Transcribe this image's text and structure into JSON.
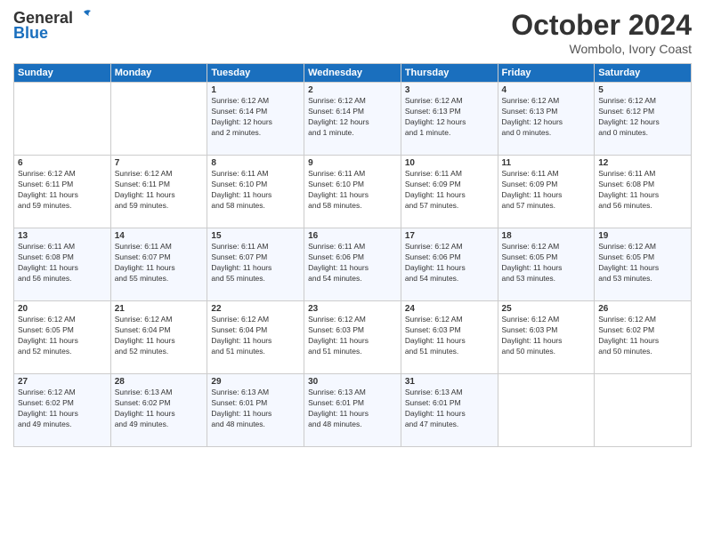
{
  "logo": {
    "line1": "General",
    "line2": "Blue"
  },
  "title": "October 2024",
  "subtitle": "Wombolo, Ivory Coast",
  "days_of_week": [
    "Sunday",
    "Monday",
    "Tuesday",
    "Wednesday",
    "Thursday",
    "Friday",
    "Saturday"
  ],
  "weeks": [
    [
      {
        "day": "",
        "info": ""
      },
      {
        "day": "",
        "info": ""
      },
      {
        "day": "1",
        "info": "Sunrise: 6:12 AM\nSunset: 6:14 PM\nDaylight: 12 hours\nand 2 minutes."
      },
      {
        "day": "2",
        "info": "Sunrise: 6:12 AM\nSunset: 6:14 PM\nDaylight: 12 hours\nand 1 minute."
      },
      {
        "day": "3",
        "info": "Sunrise: 6:12 AM\nSunset: 6:13 PM\nDaylight: 12 hours\nand 1 minute."
      },
      {
        "day": "4",
        "info": "Sunrise: 6:12 AM\nSunset: 6:13 PM\nDaylight: 12 hours\nand 0 minutes."
      },
      {
        "day": "5",
        "info": "Sunrise: 6:12 AM\nSunset: 6:12 PM\nDaylight: 12 hours\nand 0 minutes."
      }
    ],
    [
      {
        "day": "6",
        "info": "Sunrise: 6:12 AM\nSunset: 6:11 PM\nDaylight: 11 hours\nand 59 minutes."
      },
      {
        "day": "7",
        "info": "Sunrise: 6:12 AM\nSunset: 6:11 PM\nDaylight: 11 hours\nand 59 minutes."
      },
      {
        "day": "8",
        "info": "Sunrise: 6:11 AM\nSunset: 6:10 PM\nDaylight: 11 hours\nand 58 minutes."
      },
      {
        "day": "9",
        "info": "Sunrise: 6:11 AM\nSunset: 6:10 PM\nDaylight: 11 hours\nand 58 minutes."
      },
      {
        "day": "10",
        "info": "Sunrise: 6:11 AM\nSunset: 6:09 PM\nDaylight: 11 hours\nand 57 minutes."
      },
      {
        "day": "11",
        "info": "Sunrise: 6:11 AM\nSunset: 6:09 PM\nDaylight: 11 hours\nand 57 minutes."
      },
      {
        "day": "12",
        "info": "Sunrise: 6:11 AM\nSunset: 6:08 PM\nDaylight: 11 hours\nand 56 minutes."
      }
    ],
    [
      {
        "day": "13",
        "info": "Sunrise: 6:11 AM\nSunset: 6:08 PM\nDaylight: 11 hours\nand 56 minutes."
      },
      {
        "day": "14",
        "info": "Sunrise: 6:11 AM\nSunset: 6:07 PM\nDaylight: 11 hours\nand 55 minutes."
      },
      {
        "day": "15",
        "info": "Sunrise: 6:11 AM\nSunset: 6:07 PM\nDaylight: 11 hours\nand 55 minutes."
      },
      {
        "day": "16",
        "info": "Sunrise: 6:11 AM\nSunset: 6:06 PM\nDaylight: 11 hours\nand 54 minutes."
      },
      {
        "day": "17",
        "info": "Sunrise: 6:12 AM\nSunset: 6:06 PM\nDaylight: 11 hours\nand 54 minutes."
      },
      {
        "day": "18",
        "info": "Sunrise: 6:12 AM\nSunset: 6:05 PM\nDaylight: 11 hours\nand 53 minutes."
      },
      {
        "day": "19",
        "info": "Sunrise: 6:12 AM\nSunset: 6:05 PM\nDaylight: 11 hours\nand 53 minutes."
      }
    ],
    [
      {
        "day": "20",
        "info": "Sunrise: 6:12 AM\nSunset: 6:05 PM\nDaylight: 11 hours\nand 52 minutes."
      },
      {
        "day": "21",
        "info": "Sunrise: 6:12 AM\nSunset: 6:04 PM\nDaylight: 11 hours\nand 52 minutes."
      },
      {
        "day": "22",
        "info": "Sunrise: 6:12 AM\nSunset: 6:04 PM\nDaylight: 11 hours\nand 51 minutes."
      },
      {
        "day": "23",
        "info": "Sunrise: 6:12 AM\nSunset: 6:03 PM\nDaylight: 11 hours\nand 51 minutes."
      },
      {
        "day": "24",
        "info": "Sunrise: 6:12 AM\nSunset: 6:03 PM\nDaylight: 11 hours\nand 51 minutes."
      },
      {
        "day": "25",
        "info": "Sunrise: 6:12 AM\nSunset: 6:03 PM\nDaylight: 11 hours\nand 50 minutes."
      },
      {
        "day": "26",
        "info": "Sunrise: 6:12 AM\nSunset: 6:02 PM\nDaylight: 11 hours\nand 50 minutes."
      }
    ],
    [
      {
        "day": "27",
        "info": "Sunrise: 6:12 AM\nSunset: 6:02 PM\nDaylight: 11 hours\nand 49 minutes."
      },
      {
        "day": "28",
        "info": "Sunrise: 6:13 AM\nSunset: 6:02 PM\nDaylight: 11 hours\nand 49 minutes."
      },
      {
        "day": "29",
        "info": "Sunrise: 6:13 AM\nSunset: 6:01 PM\nDaylight: 11 hours\nand 48 minutes."
      },
      {
        "day": "30",
        "info": "Sunrise: 6:13 AM\nSunset: 6:01 PM\nDaylight: 11 hours\nand 48 minutes."
      },
      {
        "day": "31",
        "info": "Sunrise: 6:13 AM\nSunset: 6:01 PM\nDaylight: 11 hours\nand 47 minutes."
      },
      {
        "day": "",
        "info": ""
      },
      {
        "day": "",
        "info": ""
      }
    ]
  ]
}
